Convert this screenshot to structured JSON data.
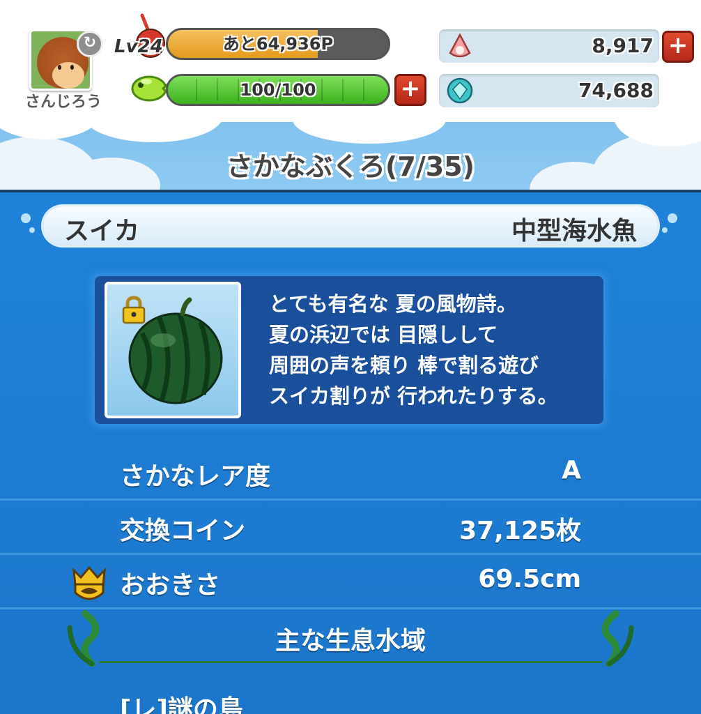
{
  "player": {
    "name": "さんじろう",
    "level_label": "Lv24",
    "exp_text": "あと64,936P",
    "stamina_text": "100/100",
    "stamina_fraction": 1.0,
    "exp_fraction": 0.68
  },
  "currency": {
    "pearls": "8,917",
    "gems": "74,688"
  },
  "screen": {
    "title": "さかなぶくろ(7/35)"
  },
  "fish": {
    "name": "スイカ",
    "category": "中型海水魚",
    "description": "とても有名な 夏の風物詩。\n夏の浜辺では 目隠しして\n周囲の声を頼り 棒で割る遊び\nスイカ割りが 行われたりする。",
    "image_icon": "watermelon-icon",
    "locked_icon": "padlock-icon"
  },
  "stats": [
    {
      "label": "さかなレア度",
      "value": "A"
    },
    {
      "label": "交換コイン",
      "value": "37,125枚"
    },
    {
      "label": "おおきさ",
      "value": "69.5cm"
    }
  ],
  "habitat": {
    "heading": "主な生息水域",
    "items": [
      "[レ]謎の島"
    ]
  },
  "colors": {
    "panel_blue": "#1e7fd6",
    "exp_orange": "#e49a1c",
    "stamina_green": "#3bb21d",
    "plus_red": "#c0301e"
  }
}
